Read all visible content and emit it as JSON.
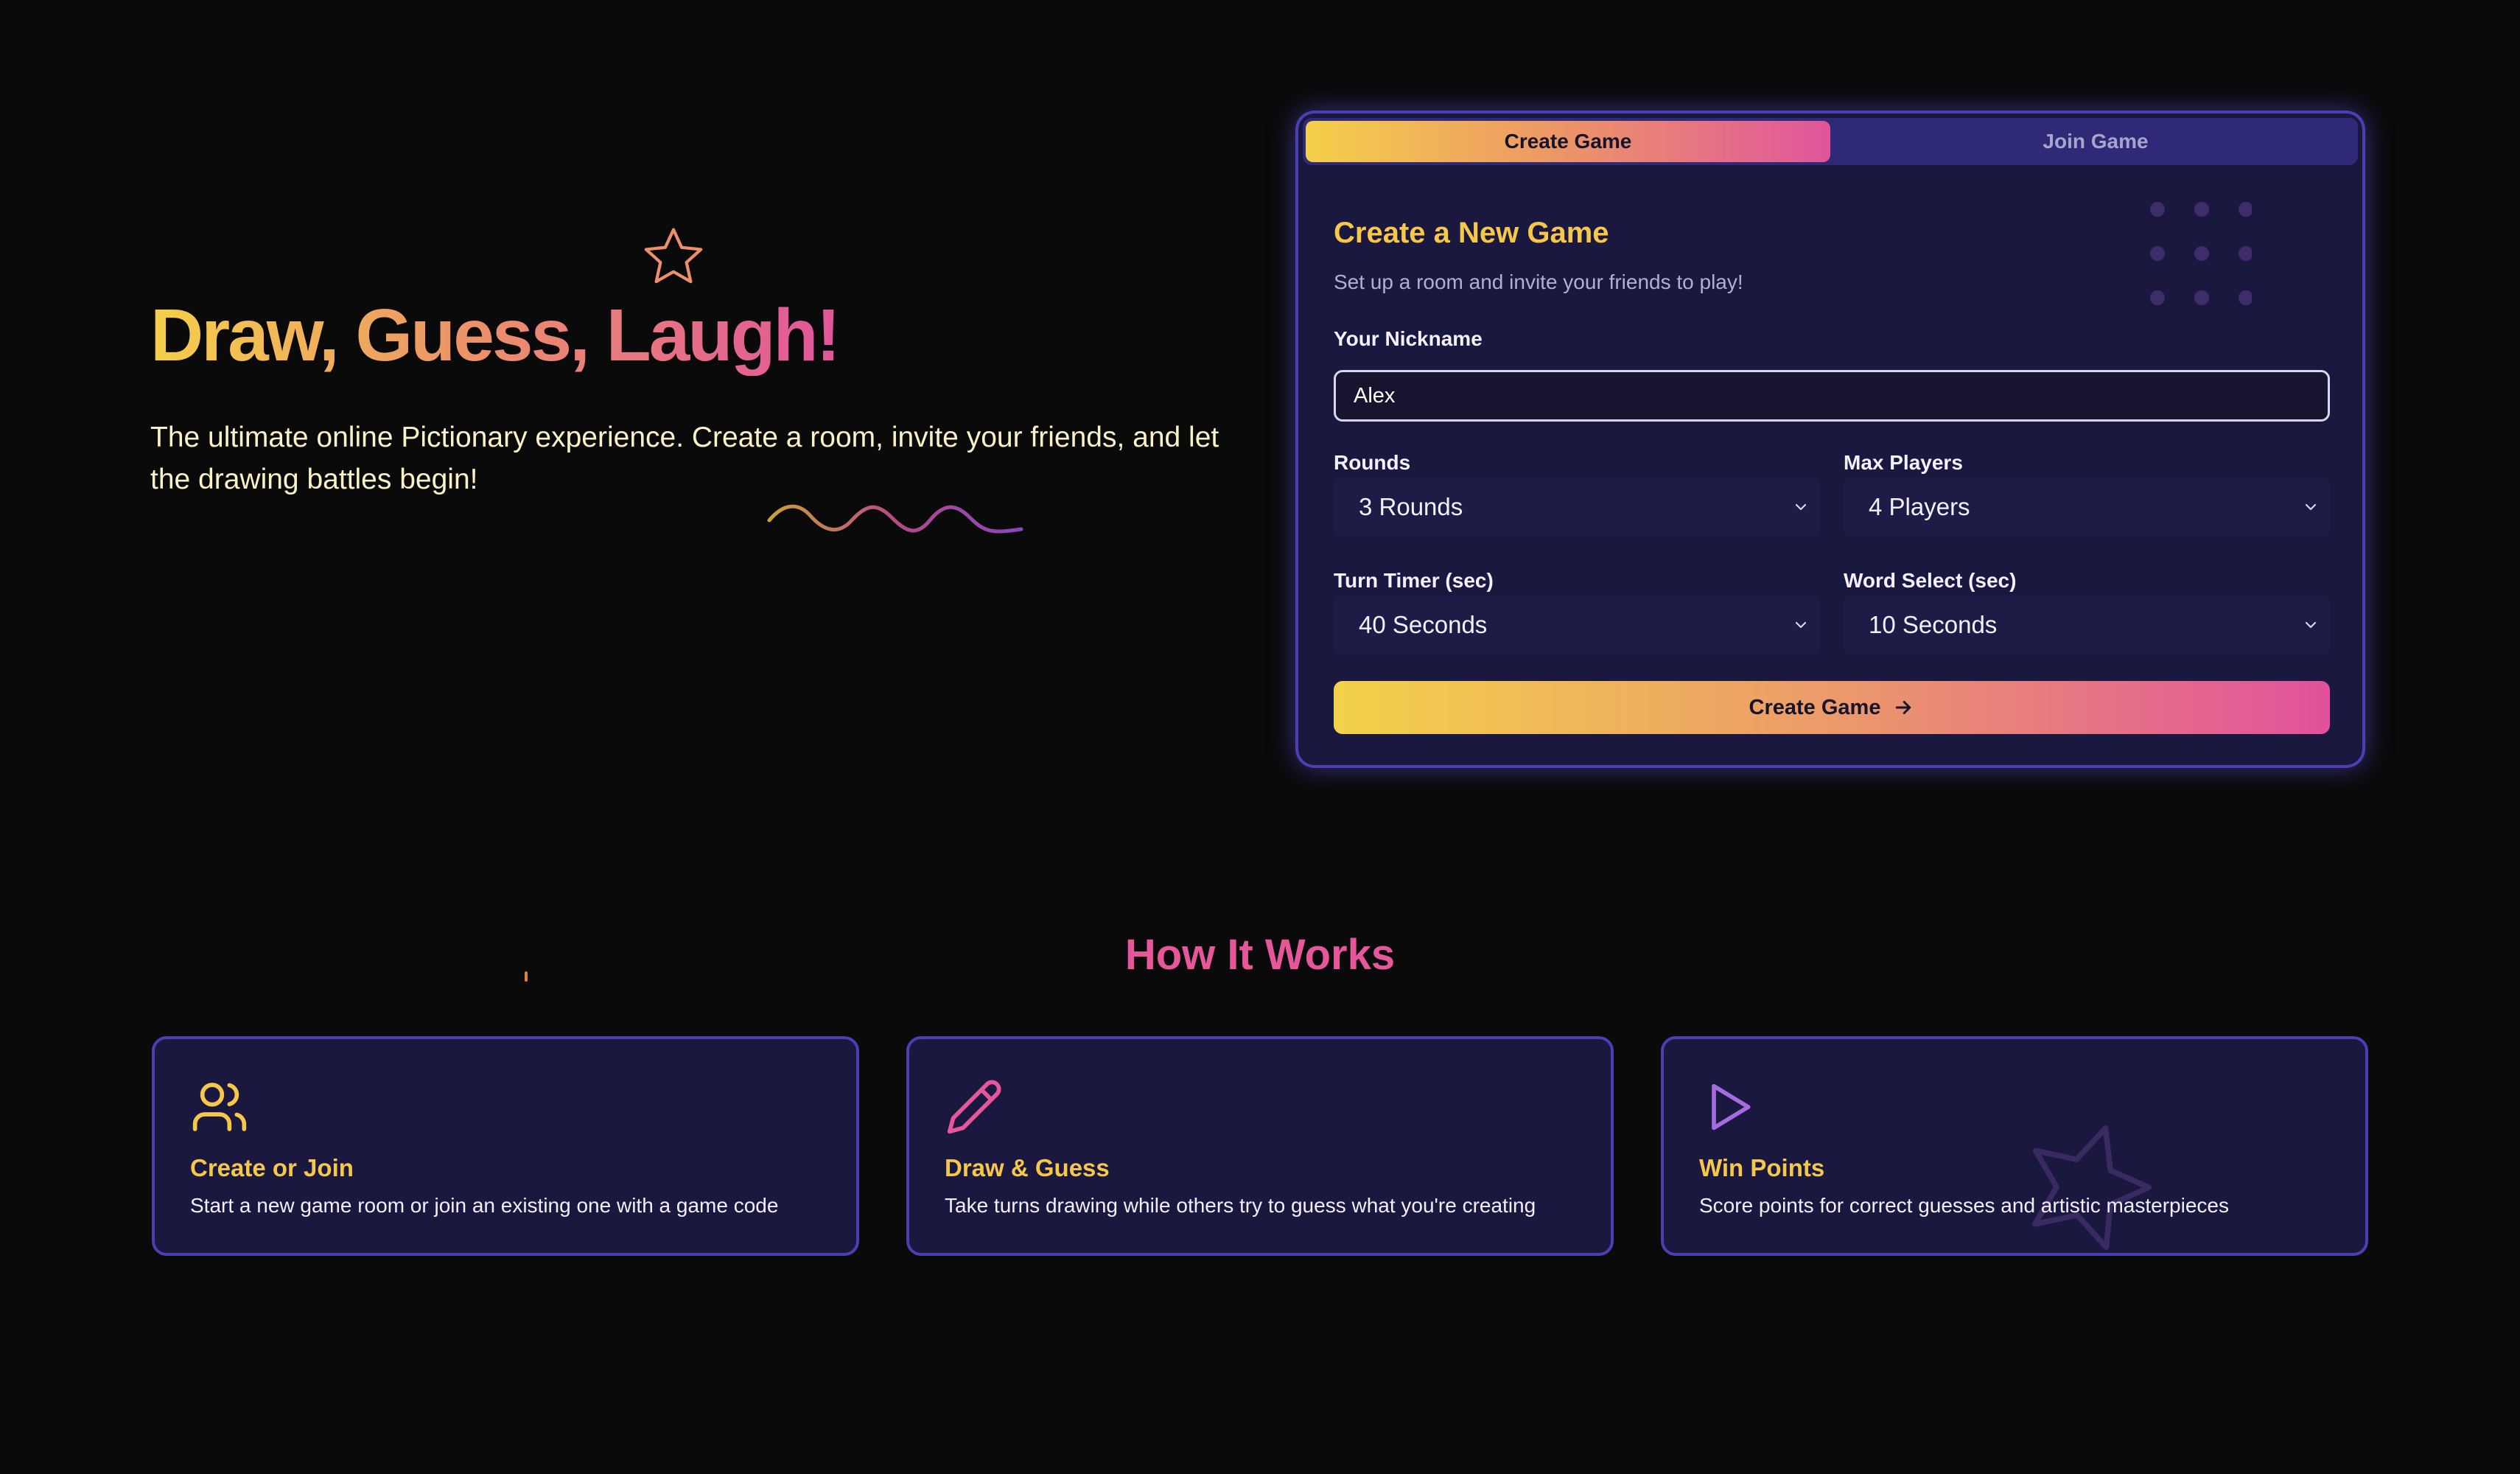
{
  "hero": {
    "title": "Draw, Guess, Laugh!",
    "subtitle": "The ultimate online Pictionary experience. Create a room, invite your friends, and let the drawing battles begin!"
  },
  "card": {
    "tabs": {
      "create": "Create Game",
      "join": "Join Game"
    },
    "title": "Create a New Game",
    "subtitle": "Set up a room and invite your friends to play!",
    "nickname": {
      "label": "Your Nickname",
      "value": "Alex"
    },
    "rounds": {
      "label": "Rounds",
      "value": "3 Rounds"
    },
    "max_players": {
      "label": "Max Players",
      "value": "4 Players"
    },
    "turn_timer": {
      "label": "Turn Timer (sec)",
      "value": "40 Seconds"
    },
    "word_select": {
      "label": "Word Select (sec)",
      "value": "10 Seconds"
    },
    "create_button": "Create Game"
  },
  "how_it_works": {
    "title": "How It Works",
    "features": [
      {
        "icon": "users-icon",
        "title": "Create or Join",
        "text": "Start a new game room or join an existing one with a game code"
      },
      {
        "icon": "pencil-icon",
        "title": "Draw & Guess",
        "text": "Take turns drawing while others try to guess what you're creating"
      },
      {
        "icon": "play-icon",
        "title": "Win Points",
        "text": "Score points for correct guesses and artistic masterpieces"
      }
    ]
  },
  "colors": {
    "background": "#0a0a0b",
    "card": "#1b1840",
    "border": "#4a40b2",
    "accent_yellow": "#f5c84a",
    "accent_pink": "#e0559c"
  }
}
